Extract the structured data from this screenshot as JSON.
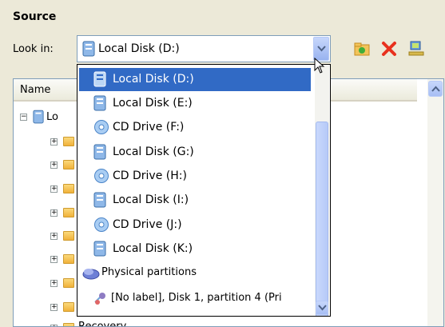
{
  "section_title": "Source",
  "look_in": {
    "label": "Look in:",
    "value": "Local Disk (D:)"
  },
  "toolbar": {
    "icons": [
      "new-folder-icon",
      "delete-icon",
      "network-icon"
    ]
  },
  "tree": {
    "column_name": "Name",
    "root_label": "Lo",
    "bottom_partial_label": "Recovery"
  },
  "dropdown": {
    "items": [
      {
        "label": "Local Disk (D:)",
        "icon": "disk-icon",
        "selected": true
      },
      {
        "label": "Local Disk (E:)",
        "icon": "disk-icon"
      },
      {
        "label": "CD Drive (F:)",
        "icon": "cd-drive-icon"
      },
      {
        "label": "Local Disk (G:)",
        "icon": "disk-icon"
      },
      {
        "label": "CD Drive (H:)",
        "icon": "cd-drive-icon"
      },
      {
        "label": "Local Disk (I:)",
        "icon": "disk-icon"
      },
      {
        "label": "CD Drive (J:)",
        "icon": "cd-drive-icon"
      },
      {
        "label": "Local Disk (K:)",
        "icon": "disk-icon"
      },
      {
        "label": "Physical partitions",
        "icon": "physical-partitions-icon"
      },
      {
        "label": "[No label], Disk 1, partition 4 (Pri",
        "icon": "partition-icon"
      }
    ]
  },
  "colors": {
    "selection": "#316ac5",
    "panel_border": "#7f9db9",
    "window_bg": "#ece9d8"
  }
}
